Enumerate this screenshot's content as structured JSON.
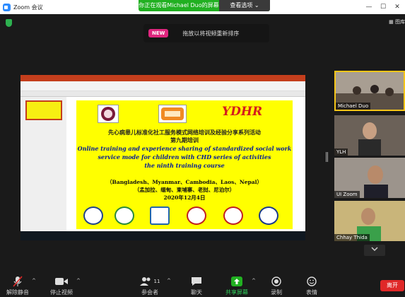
{
  "window": {
    "title": "Zoom 会议",
    "controls": {
      "minimize": "—",
      "maximize": "☐",
      "close": "✕"
    }
  },
  "share_banner": {
    "text": "你正在观看Michael Duo的屏幕",
    "options_label": "查看选项 ⌄"
  },
  "gallery_view_label": "▦ 图库",
  "toast": {
    "badge": "NEW",
    "message": "拖放以将视频重新排序"
  },
  "slide": {
    "logo_text": "YDHR",
    "line_cn_title": "先心病患儿标准化社工服务模式网络培训及经验分享系列活动",
    "line_cn_sub": "第九期培训",
    "line_en_1": "Online training and experience sharing of standardized social work",
    "line_en_2": "service mode for children with CHD series of activities",
    "line_en_3": "the ninth training course",
    "countries_en": "（Bangladesh、Myanmar、Cambodia、Laos、Nepal）",
    "countries_cn": "（孟加拉、缅甸、柬埔寨、老挝、尼泊尔）",
    "date": "2020年12月4日"
  },
  "participants": [
    {
      "name": "Michael Duo",
      "active": true,
      "scene_color": "#8a7f72"
    },
    {
      "name": "YLH",
      "active": false,
      "scene_color": "#6b6158"
    },
    {
      "name": "UI Zoom",
      "active": false,
      "scene_color": "#9c948c"
    },
    {
      "name": "Chhay Thida",
      "active": false,
      "scene_color": "#c9b57a"
    }
  ],
  "toolbar": {
    "mute": "解除静音",
    "video": "停止视频",
    "participants": "参会者",
    "participants_count": "11",
    "chat": "聊天",
    "share": "共享屏幕",
    "record": "录制",
    "reactions": "表情",
    "end": "离开"
  },
  "colors": {
    "share_green": "#21b021",
    "new_badge": "#e0257e",
    "end_red": "#e02828",
    "active_border": "#f5c518",
    "slide_yellow": "#ffff00"
  }
}
